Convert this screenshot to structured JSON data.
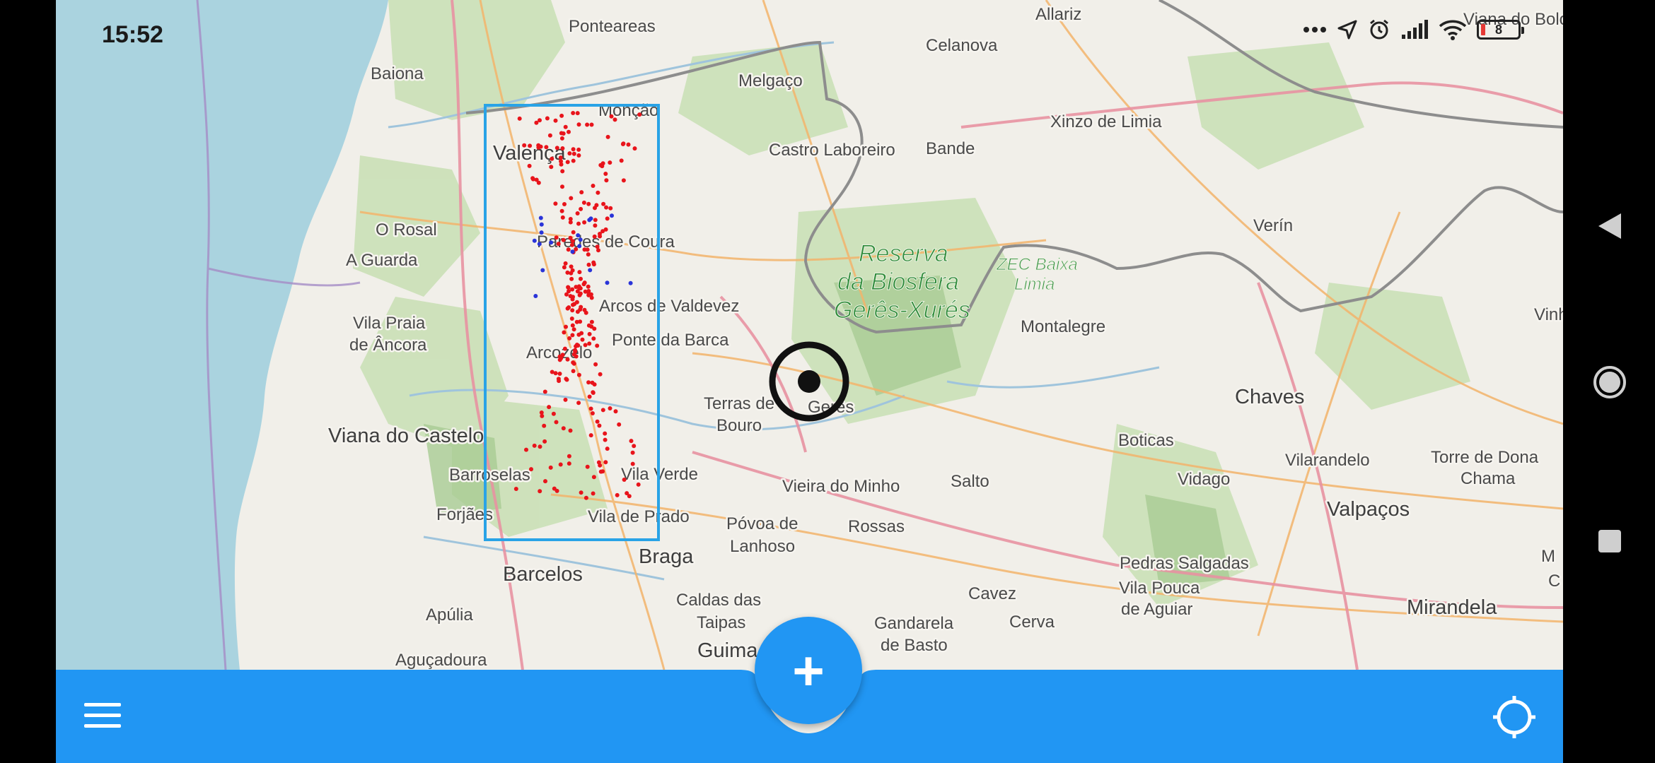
{
  "status_bar": {
    "time": "15:52",
    "icons": [
      "more-dots-icon",
      "location-arrow-icon",
      "alarm-icon",
      "signal-icon",
      "wifi-icon",
      "battery-icon"
    ],
    "battery_level": "8",
    "battery_color": "#e53935"
  },
  "map": {
    "labels": {
      "ponteareas": "Ponteareas",
      "allariz": "Allariz",
      "viana_do_bolo": "Viana do Bolo",
      "baiona": "Baiona",
      "celanova": "Celanova",
      "melgaco": "Melgaço",
      "moncao": "Monção",
      "xinzo": "Xinzo de Limia",
      "castro_laboreiro": "Castro Laboreiro",
      "bande": "Bande",
      "valenca": "Valença",
      "verin": "Verín",
      "o_rosal": "O Rosal",
      "a_guarda": "A Guarda",
      "paredes_de_coura": "Paredes de Coura",
      "reserva_1": "Reserva",
      "reserva_2": "da Biosfera",
      "reserva_3": "Gerês-Xurés",
      "zec_1": "ZEC Baixa",
      "zec_2": "Limia",
      "vila_praia_1": "Vila Praia",
      "vila_praia_2": "de Âncora",
      "arcos": "Arcos de Valdevez",
      "montalegre": "Montalegre",
      "vinh": "Vinh",
      "ponte_da_barca": "Ponte da Barca",
      "arcozelo": "Arcozelo",
      "chaves": "Chaves",
      "terras_1": "Terras de",
      "terras_2": "Bouro",
      "geres": "Gerês",
      "viana_castelo": "Viana do Castelo",
      "boticas": "Boticas",
      "barroselas": "Barroselas",
      "vila_verde": "Vila Verde",
      "vilarandelo": "Vilarandelo",
      "torre_1": "Torre de Dona",
      "torre_2": "Chama",
      "vidago": "Vidago",
      "vieira": "Vieira do Minho",
      "salto": "Salto",
      "forjaes": "Forjães",
      "vila_de_prado": "Vila de Prado",
      "valpacos": "Valpaços",
      "povoa_1": "Póvoa de",
      "povoa_2": "Lanhoso",
      "rossas": "Rossas",
      "braga": "Braga",
      "barcelos": "Barcelos",
      "pedras": "Pedras Salgadas",
      "vila_pouca_1": "Vila Pouca",
      "vila_pouca_2": "de Aguiar",
      "m_edge": "M",
      "c_edge": "C",
      "caldas_1": "Caldas das",
      "caldas_2": "Taipas",
      "cavez": "Cavez",
      "mirandela": "Mirandela",
      "apulia": "Apúlia",
      "gandarela_1": "Gandarela",
      "gandarela_2": "de Basto",
      "cerva": "Cerva",
      "guima": "Guima",
      "acucadoura": "Aguçadoura"
    },
    "colors": {
      "sea": "#aad3df",
      "land": "#f1efe9",
      "forest": "#add19e",
      "selection_box": "#29a3e6",
      "red_points": "#e8141b",
      "blue_points": "#2a34d8",
      "border": "#8a8a8a"
    }
  },
  "bottom_bar": {
    "color": "#2196f3",
    "menu_icon": "hamburger-menu-icon",
    "fab_icon": "plus-icon",
    "fab_label": "+",
    "locate_icon": "crosshair-icon"
  },
  "nav_bar": {
    "icons": [
      "back-triangle-icon",
      "home-circle-icon",
      "recent-square-icon"
    ]
  }
}
